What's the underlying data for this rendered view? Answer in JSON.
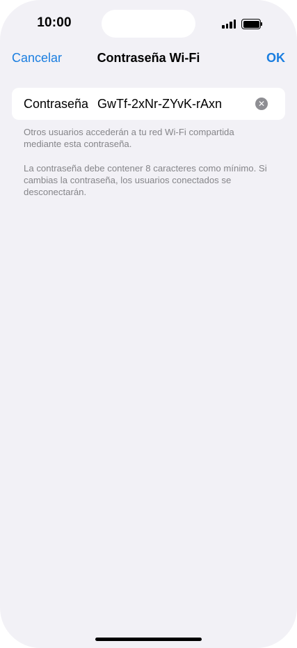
{
  "status_bar": {
    "time": "10:00",
    "signal_icon": "cellular-signal-icon",
    "battery_icon": "battery-full-icon"
  },
  "nav": {
    "cancel_label": "Cancelar",
    "title": "Contraseña Wi-Fi",
    "ok_label": "OK"
  },
  "password_field": {
    "label": "Contraseña",
    "value": "GwTf-2xNr-ZYvK-rAxn",
    "clear_icon": "clear-circle-icon"
  },
  "footnotes": [
    "Otros usuarios accederán a tu red Wi-Fi compartida mediante esta contraseña.",
    "La contraseña debe contener 8 caracteres como mínimo. Si cambias la contraseña, los usuarios conectados se desconectarán."
  ],
  "colors": {
    "accent": "#1a7ee0",
    "background": "#f2f1f6",
    "secondary_text": "#858589"
  }
}
